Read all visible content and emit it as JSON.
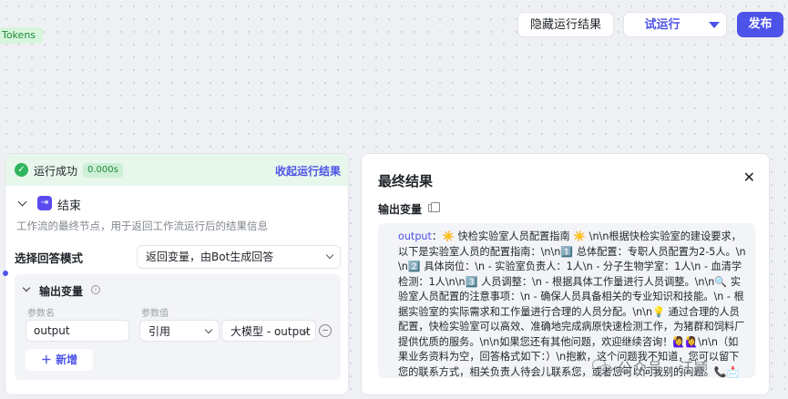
{
  "topbar": {
    "tokens_chip": "Tokens",
    "hide_results_label": "隐藏运行结果",
    "test_run_label": "试运行",
    "publish_label": "发布"
  },
  "run_panel": {
    "status_text": "运行成功",
    "duration": "0.000s",
    "collapse_label": "收起运行结果",
    "node_title": "结束",
    "node_description": "工作流的最终节点，用于返回工作流运行后的结果信息",
    "answer_mode_label": "选择回答模式",
    "answer_mode_value": "返回变量，由Bot生成回答",
    "output_section_title": "输出变量",
    "param_name_header": "参数名",
    "param_value_header": "参数值",
    "param_name_value": "output",
    "reference_type": "引用",
    "reference_source": "大模型 - output",
    "add_label": "新增"
  },
  "result_panel": {
    "title": "最终结果",
    "output_label": "输出变量",
    "result_key": "output",
    "result_text": "：☀️ 快检实验室人员配置指南 ☀️ \\n\\n根据快检实验室的建设要求，以下是实验室人员的配置指南：\\n\\n1️⃣ 总体配置：专职人员配置为2-5人。\\n\\n2️⃣ 具体岗位：\\n  - 实验室负责人：1人\\n  - 分子生物学室：1人\\n  - 血清学检测：1人\\n\\n3️⃣ 人员调整：\\n  - 根据具体工作量进行人员调整。\\n\\n🔍 实验室人员配置的注意事项：\\n  - 确保人员具备相关的专业知识和技能。\\n  - 根据实验室的实际需求和工作量进行合理的人员分配。\\n\\n💡 通过合理的人员配置，快检实验室可以高效、准确地完成病原快速检测工作，为猪群和饲料厂提供优质的服务。\\n\\n如果您还有其他问题，欢迎继续咨询！🙋‍♀️🙋‍♀️\\n\\n（如果业务资料为空，回答格式如下：）\\n抱歉，这个问题我不知道，您可以留下您的联系方式，相关负责人待会儿联系您，或者您可以问我别的问题。📞📩"
  },
  "watermark": "公众号 · 汪颖"
}
